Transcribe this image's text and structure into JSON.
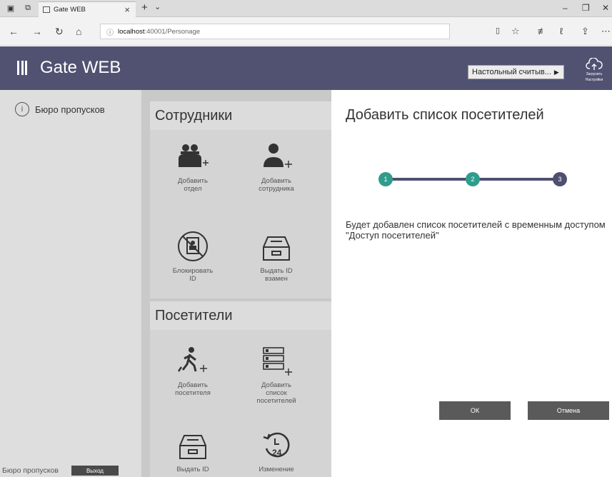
{
  "browser": {
    "tab_title": "Gate WEB",
    "url_host": "localhost",
    "url_rest": ":40001/Personage"
  },
  "app": {
    "title": "Gate WEB",
    "reader_label": "Настольный считыв...",
    "upload_label_line1": "Загрузить",
    "upload_label_line2": "Настройки"
  },
  "sidebar": {
    "item_label": "Бюро пропусков",
    "footer_label": "Бюро пропусков",
    "logout_label": "Выход"
  },
  "employees": {
    "header": "Сотрудники",
    "add_department": [
      "Добавить",
      "отдел"
    ],
    "add_employee": [
      "Добавить",
      "сотрудника"
    ],
    "block_id": [
      "Блокировать",
      "ID"
    ],
    "issue_id_replacement": [
      "Выдать ID",
      "взамен"
    ]
  },
  "visitors": {
    "header": "Посетители",
    "add_visitor": [
      "Добавить",
      "посетителя"
    ],
    "add_visitor_list": [
      "Добавить",
      "список",
      "посетителей"
    ],
    "issue_id": [
      "Выдать ID"
    ],
    "change": [
      "Изменение"
    ]
  },
  "dialog": {
    "title": "Добавить список посетителей",
    "steps": [
      "1",
      "2",
      "3"
    ],
    "step_colors": [
      "#2f9c8c",
      "#2f9c8c",
      "#4f5070"
    ],
    "message": "Будет добавлен список посетителей с временным доступом \"Доступ посетителей\"",
    "ok_label": "ОК",
    "cancel_label": "Отмена"
  },
  "icons": [
    "tab-icon",
    "back-icon",
    "forward-icon",
    "refresh-icon",
    "home-icon",
    "info-icon",
    "reading-view-icon",
    "favorite-icon",
    "favorites-list-icon",
    "pen-icon",
    "share-icon",
    "more-icon",
    "menu-icon",
    "cloud-upload-icon",
    "pass-bureau-icon",
    "department-icon",
    "add-employee-icon",
    "block-id-icon",
    "tray-icon",
    "walking-visitor-icon",
    "visitor-list-icon",
    "history-24-icon"
  ]
}
